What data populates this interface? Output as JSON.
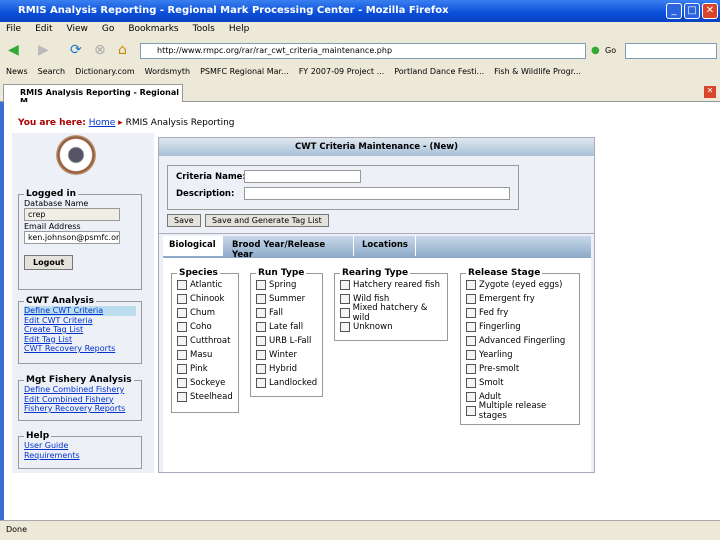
{
  "window": {
    "title": "RMIS Analysis Reporting - Regional Mark Processing Center - Mozilla Firefox"
  },
  "menu": [
    "File",
    "Edit",
    "View",
    "Go",
    "Bookmarks",
    "Tools",
    "Help"
  ],
  "url": "http://www.rmpc.org/rar/rar_cwt_criteria_maintenance.php",
  "go_label": "Go",
  "bookmarks": [
    "News",
    "Search",
    "Dictionary.com",
    "Wordsmyth",
    "PSMFC Regional Mar...",
    "FY 2007-09 Project ...",
    "Portland Dance Festi...",
    "Fish & Wildlife Progr..."
  ],
  "tab": "RMIS Analysis Reporting - Regional M...",
  "status": "Done",
  "breadcrumb": {
    "prefix": "You are here:",
    "home": "Home",
    "sep": "▸",
    "current": "RMIS Analysis Reporting"
  },
  "login": {
    "legend": "Logged in",
    "db_label": "Database Name",
    "db_value": "crep",
    "email_label": "Email Address",
    "email_value": "ken.johnson@psmfc.org",
    "logout": "Logout"
  },
  "cwt": {
    "legend": "CWT Analysis",
    "items": [
      "Define CWT Criteria",
      "Edit CWT Criteria",
      "Create Tag List",
      "Edit Tag List",
      "CWT Recovery Reports"
    ]
  },
  "mgt": {
    "legend": "Mgt Fishery Analysis",
    "items": [
      "Define Combined Fishery",
      "Edit Combined Fishery",
      "Fishery Recovery Reports"
    ]
  },
  "help": {
    "legend": "Help",
    "items": [
      "User Guide",
      "Requirements"
    ]
  },
  "panel": {
    "title": "CWT Criteria Maintenance - (New)",
    "name_label": "Criteria Name:",
    "name_value": "",
    "desc_label": "Description:",
    "desc_value": "",
    "save": "Save",
    "save_gen": "Save and Generate Tag List",
    "tabs": [
      "Biological",
      "Brood Year/Release Year",
      "Locations"
    ],
    "active_tab": "Biological"
  },
  "groups": [
    {
      "legend": "Species",
      "items": [
        "Atlantic",
        "Chinook",
        "Chum",
        "Coho",
        "Cutthroat",
        "Masu",
        "Pink",
        "Sockeye",
        "Steelhead"
      ]
    },
    {
      "legend": "Run Type",
      "items": [
        "Spring",
        "Summer",
        "Fall",
        "Late fall",
        "URB L-Fall",
        "Winter",
        "Hybrid",
        "Landlocked"
      ]
    },
    {
      "legend": "Rearing Type",
      "items": [
        "Hatchery reared fish",
        "Wild fish",
        "Mixed hatchery & wild",
        "Unknown"
      ]
    },
    {
      "legend": "Release Stage",
      "items": [
        "Zygote (eyed eggs)",
        "Emergent fry",
        "Fed fry",
        "Fingerling",
        "Advanced Fingerling",
        "Yearling",
        "Pre-smolt",
        "Smolt",
        "Adult",
        "Multiple release stages"
      ]
    }
  ]
}
